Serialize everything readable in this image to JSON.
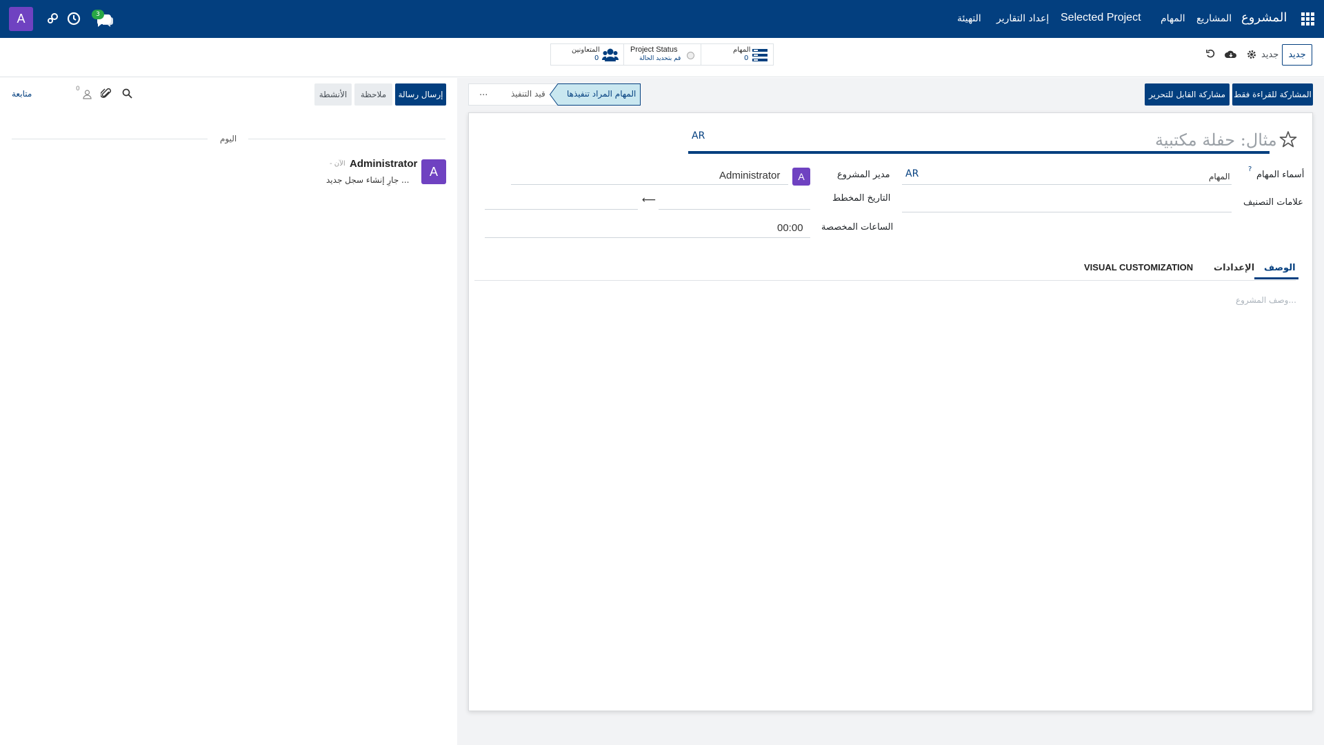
{
  "navbar": {
    "app_name": "المشروع",
    "menu": [
      "المشاريع",
      "المهام",
      "Selected Project",
      "إعداد التقارير",
      "التهيئة"
    ],
    "messages_badge": "3",
    "user_initial": "A"
  },
  "controlbar": {
    "new_button": "جديد",
    "record_label": "جديد",
    "stats": {
      "tasks_label": "المهام",
      "tasks_count": "0",
      "status_label": "Project Status",
      "status_sub": "قم بتحديد الحالة",
      "collaborators_label": "المتعاونين",
      "collaborators_count": "0"
    }
  },
  "statusbar": {
    "share_readonly": "المشاركة للقراءة فقط",
    "share_editable": "مشاركة القابل للتحرير",
    "stages": [
      "المهام المراد تنفيذها",
      "قيد التنفيذ"
    ],
    "more": "..."
  },
  "form": {
    "name_placeholder": "مثال: حفلة مكتبية",
    "lang": "AR",
    "fields": {
      "task_names_label": "أسماء المهام",
      "task_names_help": "?",
      "task_names_value": "المهام",
      "task_names_lang": "AR",
      "tags_label": "علامات التصنيف",
      "manager_label": "مدير المشروع",
      "manager_initial": "A",
      "manager_value": "Administrator",
      "planned_date_label": "التاريخ المخطط",
      "date_arrow": "⟵",
      "allocated_hours_label": "الساعات المخصصة",
      "allocated_hours_value": "00:00"
    },
    "tabs": [
      "الوصف",
      "الإعدادات",
      "VISUAL CUSTOMIZATION"
    ],
    "description_placeholder": "وصف المشروع..."
  },
  "chatter": {
    "send_message": "إرسال رسالة",
    "log_note": "ملاحظة",
    "activities": "الأنشطة",
    "followers_count": "0",
    "follow": "متابعة",
    "today": "اليوم",
    "message": {
      "author_initial": "A",
      "author": "Administrator",
      "time": "- الآن",
      "body": "جارِ إنشاء سجل جديد ..."
    }
  }
}
